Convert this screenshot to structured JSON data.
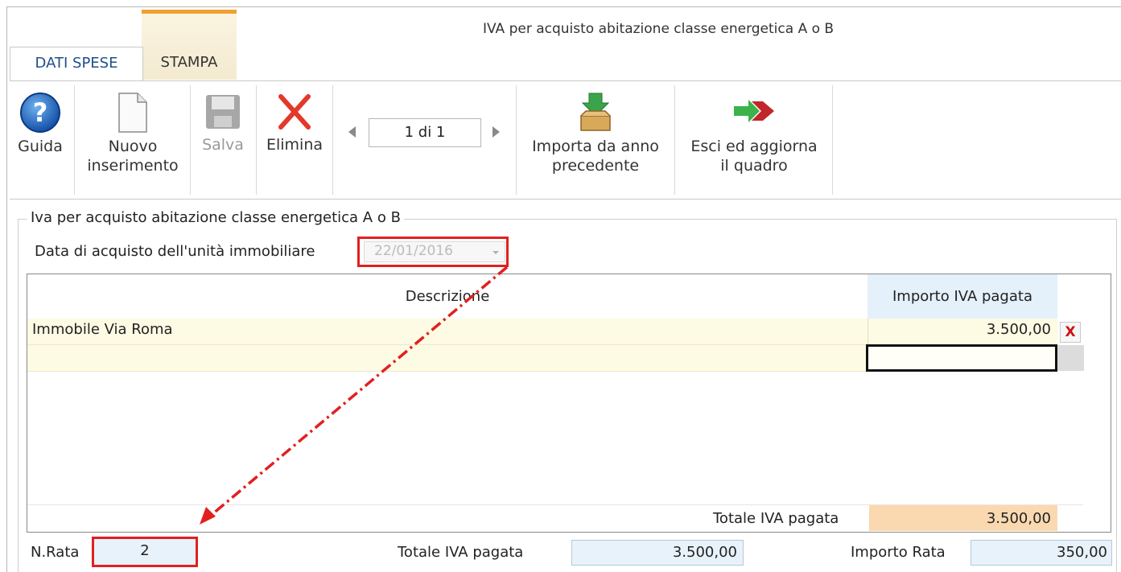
{
  "window": {
    "title": "IVA per acquisto abitazione classe energetica A o B"
  },
  "tabs": [
    {
      "label": "DATI SPESE",
      "active": true
    },
    {
      "label": "STAMPA",
      "active": false
    }
  ],
  "toolbar": {
    "guida": "Guida",
    "nuovo_line1": "Nuovo",
    "nuovo_line2": "inserimento",
    "salva": "Salva",
    "elimina": "Elimina",
    "pager": "1 di 1",
    "importa_line1": "Importa da anno",
    "importa_line2": "precedente",
    "esci_line1": "Esci ed aggiorna",
    "esci_line2": "il quadro"
  },
  "form": {
    "group_title": "Iva per acquisto abitazione classe energetica A o B",
    "date_label": "Data di acquisto dell'unità immobiliare",
    "date_value": "22/01/2016"
  },
  "grid": {
    "col_desc": "Descrizione",
    "col_importo": "Importo IVA pagata",
    "rows": [
      {
        "descrizione": "Immobile Via Roma",
        "importo": "3.500,00",
        "delete": "X"
      }
    ],
    "total_label": "Totale IVA pagata",
    "total_value": "3.500,00"
  },
  "footer": {
    "nrata_label": "N.Rata",
    "nrata_value": "2",
    "totale_label": "Totale IVA pagata",
    "totale_value": "3.500,00",
    "rata_label": "Importo Rata",
    "rata_value": "350,00"
  },
  "colors": {
    "highlight": "#e12020",
    "tab_text": "#1f4f8a",
    "row_bg": "#fdfbe4",
    "total_bg": "#fad9b0"
  },
  "icons": [
    "help-icon",
    "new-document-icon",
    "save-icon",
    "delete-icon",
    "prev-arrow-icon",
    "next-arrow-icon",
    "import-icon",
    "exit-update-icon"
  ]
}
